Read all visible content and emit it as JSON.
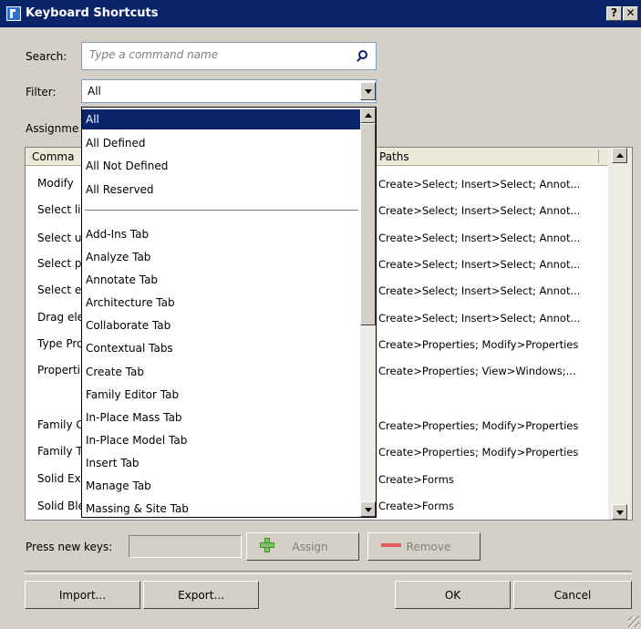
{
  "window": {
    "title": "Keyboard Shortcuts",
    "help_label": "?",
    "close_label": "✕"
  },
  "search": {
    "label": "Search:",
    "placeholder": "Type a command name"
  },
  "filter": {
    "label": "Filter:",
    "value": "All",
    "options": [
      "All",
      "All Defined",
      "All Not Defined",
      "All Reserved",
      "Add-Ins Tab",
      "Analyze Tab",
      "Annotate Tab",
      "Architecture Tab",
      "Collaborate Tab",
      "Contextual Tabs",
      "Create Tab",
      "Family Editor Tab",
      "In-Place Mass Tab",
      "In-Place Model Tab",
      "Insert Tab",
      "Manage Tab",
      "Massing & Site Tab"
    ]
  },
  "assignments": {
    "label": "Assignme",
    "col_command": "Comma",
    "col_paths": "Paths",
    "rows": [
      {
        "command": "Modify",
        "paths": "Create>Select; Insert>Select; Annot..."
      },
      {
        "command": "Select li",
        "paths": "Create>Select; Insert>Select; Annot..."
      },
      {
        "command": "Select u",
        "paths": "Create>Select; Insert>Select; Annot..."
      },
      {
        "command": "Select pi",
        "paths": "Create>Select; Insert>Select; Annot..."
      },
      {
        "command": "Select el",
        "paths": "Create>Select; Insert>Select; Annot..."
      },
      {
        "command": "Drag ele",
        "paths": "Create>Select; Insert>Select; Annot..."
      },
      {
        "command": "Type Pro",
        "paths": "Create>Properties; Modify>Properties"
      },
      {
        "command": "Properti",
        "paths": "Create>Properties; View>Windows;..."
      },
      {
        "command": "Family C",
        "paths": "Create>Properties; Modify>Properties"
      },
      {
        "command": "Family T",
        "paths": "Create>Properties; Modify>Properties"
      },
      {
        "command": "Solid Ext",
        "paths": "Create>Forms"
      },
      {
        "command": "Solid Ble",
        "paths": "Create>Forms"
      }
    ]
  },
  "keys": {
    "label": "Press new keys:",
    "value": ""
  },
  "buttons": {
    "assign": "Assign",
    "remove": "Remove",
    "import": "Import...",
    "export": "Export...",
    "ok": "OK",
    "cancel": "Cancel"
  }
}
